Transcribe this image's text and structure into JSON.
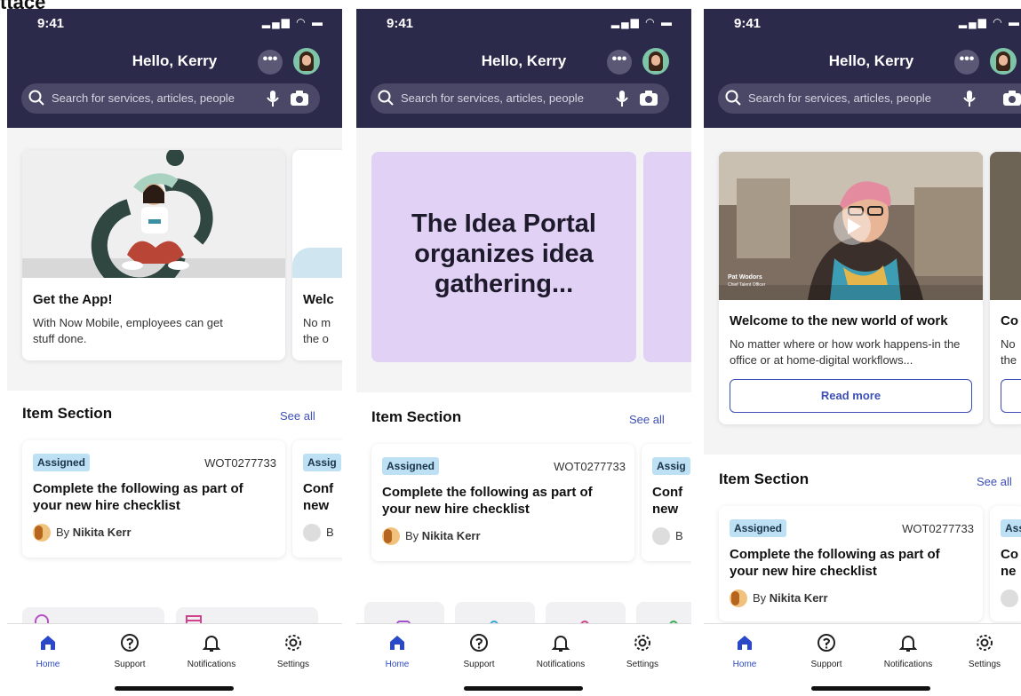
{
  "cut_label": "ttace",
  "status": {
    "time": "9:41"
  },
  "header": {
    "greeting": "Hello, Kerry",
    "more": "•••"
  },
  "search": {
    "placeholder": "Search for services, articles, people"
  },
  "hero": {
    "app_title": "Get the App!",
    "app_body": "With Now Mobile, employees can get stuff done.",
    "welcome_peek_title": "Welc",
    "welcome_peek_body_1": "No m",
    "welcome_peek_body_2": "the o",
    "idea_text": "The Idea Portal organizes idea gathering...",
    "video_title": "Welcome to the new world of work",
    "video_body": "No matter where or how work happens-in the office or at home-digital workflows...",
    "video_caption_name": "Pat Wodors",
    "video_caption_role": "Chief Talent Officer",
    "read_more": "Read more",
    "video_peek_title": "Co",
    "video_peek_body_1": "No",
    "video_peek_body_2": "the"
  },
  "items": {
    "section_title": "Item Section",
    "see_all": "See all",
    "badge": "Assigned",
    "number": "WOT0277733",
    "text": "Complete the following as part of your new hire checklist",
    "by": "By",
    "author": "Nikita Kerr",
    "peek_badge": "Assig",
    "peek_badge_short": "Ass",
    "peek_line1": "Conf",
    "peek_line2": "new",
    "peek_line1_short": "Co",
    "peek_line2_short": "ne",
    "peek_by": "B"
  },
  "tabs": [
    {
      "label": "Home",
      "icon": "home-icon"
    },
    {
      "label": "Support",
      "icon": "help-icon"
    },
    {
      "label": "Notifications",
      "icon": "bell-icon"
    },
    {
      "label": "Settings",
      "icon": "gear-icon"
    }
  ],
  "colors": {
    "header": "#2c2a4a",
    "accent": "#2a49c9",
    "idea": "#e1d1f5",
    "badge": "#bde0f5"
  }
}
